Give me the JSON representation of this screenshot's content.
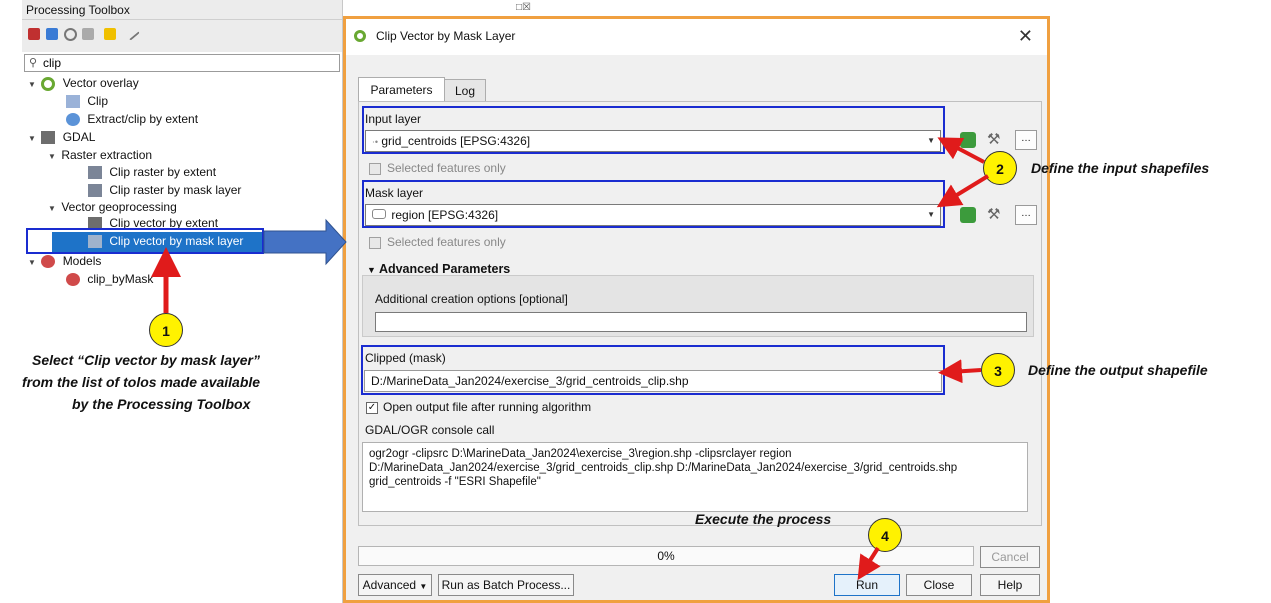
{
  "toolbox": {
    "title": "Processing Toolbox",
    "search_value": "clip",
    "tree": [
      {
        "label": "Vector overlay",
        "expanded": true
      },
      {
        "label": "Clip"
      },
      {
        "label": "Extract/clip by extent"
      },
      {
        "label": "GDAL",
        "expanded": true
      },
      {
        "label": "Raster extraction",
        "expanded": true
      },
      {
        "label": "Clip raster by extent"
      },
      {
        "label": "Clip raster by mask layer"
      },
      {
        "label": "Vector geoprocessing",
        "expanded": true
      },
      {
        "label": "Clip vector by extent"
      },
      {
        "label": "Clip vector by mask layer",
        "selected": true
      },
      {
        "label": "Models",
        "expanded": true
      },
      {
        "label": "clip_byMask"
      }
    ]
  },
  "dialog": {
    "title": "Clip Vector by Mask Layer",
    "tabs": [
      "Parameters",
      "Log"
    ],
    "input_layer_label": "Input layer",
    "input_layer_value": "grid_centroids [EPSG:4326]",
    "selected_only_1": "Selected features only",
    "mask_layer_label": "Mask layer",
    "mask_layer_value": "region [EPSG:4326]",
    "selected_only_2": "Selected features only",
    "advanced_header": "Advanced Parameters",
    "creation_options_label": "Additional creation options [optional]",
    "creation_options_value": "",
    "clipped_label": "Clipped (mask)",
    "clipped_value": "D:/MarineData_Jan2024/exercise_3/grid_centroids_clip.shp",
    "open_output_label": "Open output file after running algorithm",
    "console_label": "GDAL/OGR console call",
    "console_text": "ogr2ogr -clipsrc D:\\MarineData_Jan2024\\exercise_3\\region.shp -clipsrclayer region D:/MarineData_Jan2024/exercise_3/grid_centroids_clip.shp D:/MarineData_Jan2024/exercise_3/grid_centroids.shp grid_centroids -f \"ESRI Shapefile\"",
    "progress_text": "0%",
    "progress": 0,
    "buttons": {
      "cancel": "Cancel",
      "advanced": "Advanced",
      "batch": "Run as Batch Process...",
      "run": "Run",
      "close": "Close",
      "help": "Help"
    }
  },
  "annotations": {
    "step1": "1",
    "step2": "2",
    "step3": "3",
    "step4": "4",
    "note1_line1": "Select “Clip vector by mask layer”",
    "note1_line2": "from the list of tolos made available",
    "note1_line3": "by the Processing Toolbox",
    "note2": "Define the input shapefiles",
    "note3": "Define the output shapefile",
    "note4": "Execute the process"
  },
  "colors": {
    "highlight_frame": "#1a2cd0",
    "arrow": "#e01b1b",
    "step_fill": "#fff200",
    "selection": "#1e73c8",
    "dialog_border": "#f0a040"
  }
}
